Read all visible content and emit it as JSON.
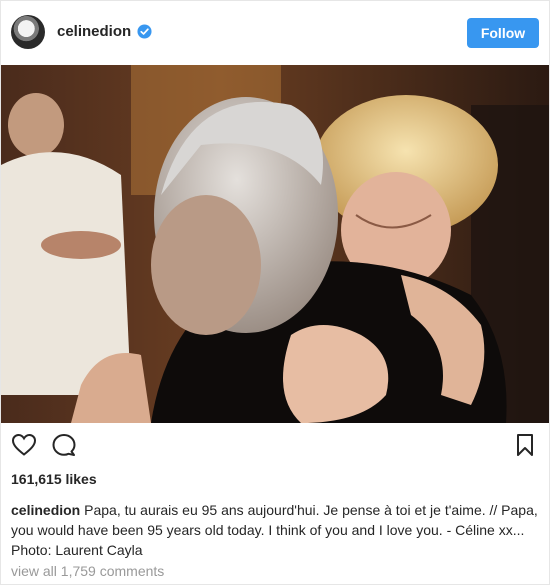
{
  "header": {
    "username": "celinedion",
    "follow_label": "Follow",
    "accent_color": "#3897f0"
  },
  "actions": {
    "like_icon": "heart-icon",
    "comment_icon": "comment-bubble-icon",
    "save_icon": "bookmark-icon"
  },
  "likes": "161,615 likes",
  "caption": {
    "username": "celinedion",
    "text": "Papa, tu aurais eu 95 ans aujourd'hui. Je pense à toi et je t'aime. // Papa, you would have been 95 years old today. I think of you and I love you. - Céline xx... Photo: Laurent Cayla"
  },
  "comments": {
    "view_all": "view all 1,759 comments"
  }
}
